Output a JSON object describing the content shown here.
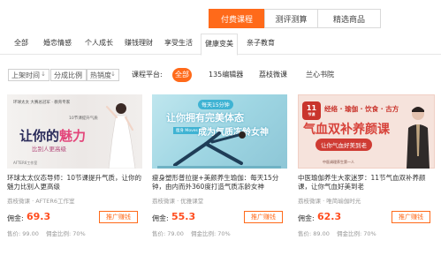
{
  "top_tabs": [
    {
      "label": "付费课程",
      "active": true
    },
    {
      "label": "测评测算",
      "active": false
    },
    {
      "label": "精选商品",
      "active": false
    }
  ],
  "categories": [
    {
      "label": "全部"
    },
    {
      "label": "婚恋情感"
    },
    {
      "label": "个人成长"
    },
    {
      "label": "赚钱理财"
    },
    {
      "label": "享受生活"
    },
    {
      "label": "健康变美",
      "active": true
    },
    {
      "label": "亲子教育"
    }
  ],
  "filters": [
    {
      "label": "上架时间"
    },
    {
      "label": "分成比例"
    },
    {
      "label": "热销度"
    }
  ],
  "platform": {
    "label": "课程平台:",
    "options": [
      {
        "label": "全部",
        "active": true
      },
      {
        "label": "135编辑器"
      },
      {
        "label": "荔枝微课"
      },
      {
        "label": "兰心书院"
      }
    ]
  },
  "colors": {
    "accent": "#ff6a1a",
    "price": "#ff4d1f"
  },
  "cards": [
    {
      "thumb": {
        "top_text": "环球太太 大赛总冠军 · 教育专家",
        "tag": "10节课提升气质",
        "headline_a": "让你的",
        "headline_b": "魅力",
        "subline": "比别人更高级",
        "foot": "AFTER6工作室"
      },
      "title": "环球太太仪态导师：10节课提升气质，让你的魅力比别人更高级",
      "source": "荔枝微课 · AFTER6工作室",
      "price_label": "佣金:",
      "price": "69.3",
      "button": "推广赚钱",
      "meta": [
        "售价: 99.00",
        "佣金比例: 70%"
      ]
    },
    {
      "thumb": {
        "badge": "每天15分钟",
        "line1": "让你拥有完美体态",
        "tag": "瘦身 Moves",
        "line2": "成为气质冻龄女神"
      },
      "title": "瘦身塑形普拉提+美颜养生瑜伽：每天15分钟，由内而外360度打造气质冻龄女神",
      "source": "荔枝微课 · 优雅课堂",
      "price_label": "佣金:",
      "price": "55.3",
      "button": "推广赚钱",
      "meta": [
        "售价: 79.00",
        "佣金比例: 70%"
      ]
    },
    {
      "thumb": {
        "num": "11",
        "num_sub": "节课",
        "top": "经络 · 瑜伽 · 饮食 · 古方",
        "head": "气血双补养颜课",
        "banner": "让你气血好美到老",
        "foot": "中医调理养生第一人"
      },
      "title": "中医瑜伽养生大家迷罗：11节气血双补养颜课，让你气血好美到老",
      "source": "荔枝微课 · 唯简瑜伽时光",
      "price_label": "佣金:",
      "price": "62.3",
      "button": "推广赚钱",
      "meta": [
        "售价: 89.00",
        "佣金比例: 70%"
      ]
    }
  ]
}
